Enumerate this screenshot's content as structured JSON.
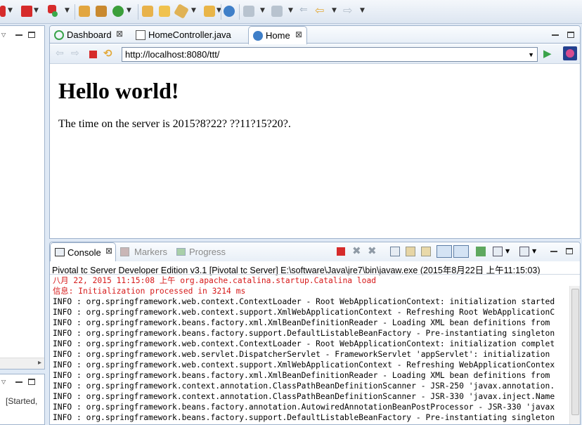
{
  "editor": {
    "tabs": [
      {
        "label": "Dashboard",
        "close": "⊠"
      },
      {
        "label": "HomeController.java"
      },
      {
        "label": "Home",
        "close": "⊠"
      }
    ],
    "url": "http://localhost:8080/ttt/",
    "page": {
      "heading": "Hello world!",
      "text": "The time on the server is 2015?8?22? ??11?15?20?."
    }
  },
  "left": {
    "hscroll_arrow": "▸",
    "server_status": "[Started,"
  },
  "console": {
    "tabs": [
      {
        "label": "Console",
        "close": "⊠"
      },
      {
        "label": "Markers"
      },
      {
        "label": "Progress"
      }
    ],
    "description": "Pivotal tc Server Developer Edition v3.1 [Pivotal tc Server] E:\\software\\Java\\jre7\\bin\\javaw.exe (2015年8月22日 上午11:15:03)",
    "lines": [
      {
        "text": "八月 22, 2015 11:15:08 上午 org.apache.catalina.startup.Catalina load",
        "level": "error"
      },
      {
        "text": "信息: Initialization processed in 3214 ms",
        "level": "error"
      },
      {
        "text": "INFO : org.springframework.web.context.ContextLoader - Root WebApplicationContext: initialization started",
        "level": "info"
      },
      {
        "text": "INFO : org.springframework.web.context.support.XmlWebApplicationContext - Refreshing Root WebApplicationC",
        "level": "info"
      },
      {
        "text": "INFO : org.springframework.beans.factory.xml.XmlBeanDefinitionReader - Loading XML bean definitions from",
        "level": "info"
      },
      {
        "text": "INFO : org.springframework.beans.factory.support.DefaultListableBeanFactory - Pre-instantiating singleton",
        "level": "info"
      },
      {
        "text": "INFO : org.springframework.web.context.ContextLoader - Root WebApplicationContext: initialization complet",
        "level": "info"
      },
      {
        "text": "INFO : org.springframework.web.servlet.DispatcherServlet - FrameworkServlet 'appServlet': initialization",
        "level": "info"
      },
      {
        "text": "INFO : org.springframework.web.context.support.XmlWebApplicationContext - Refreshing WebApplicationContex",
        "level": "info"
      },
      {
        "text": "INFO : org.springframework.beans.factory.xml.XmlBeanDefinitionReader - Loading XML bean definitions from",
        "level": "info"
      },
      {
        "text": "INFO : org.springframework.context.annotation.ClassPathBeanDefinitionScanner - JSR-250 'javax.annotation.",
        "level": "info"
      },
      {
        "text": "INFO : org.springframework.context.annotation.ClassPathBeanDefinitionScanner - JSR-330 'javax.inject.Name",
        "level": "info"
      },
      {
        "text": "INFO : org.springframework.beans.factory.annotation.AutowiredAnnotationBeanPostProcessor - JSR-330 'javax",
        "level": "info"
      },
      {
        "text": "INFO : org.springframework.beans.factory.support.DefaultListableBeanFactory - Pre-instantiating singleton",
        "level": "info"
      }
    ]
  },
  "colors": {
    "error": "#d61a1a",
    "info": "#000000",
    "accent": "#2a73c4"
  },
  "icons": [
    "run-icon",
    "stop-icon",
    "debug-icon",
    "new-server-icon",
    "open-type-icon",
    "search-icon",
    "globe-icon",
    "back-icon",
    "forward-icon",
    "refresh-icon",
    "go-icon",
    "console-icon",
    "markers-icon",
    "progress-icon",
    "terminate-icon",
    "remove-icon",
    "clear-console-icon",
    "scroll-lock-icon",
    "pin-icon",
    "display-console-icon",
    "open-console-icon"
  ]
}
